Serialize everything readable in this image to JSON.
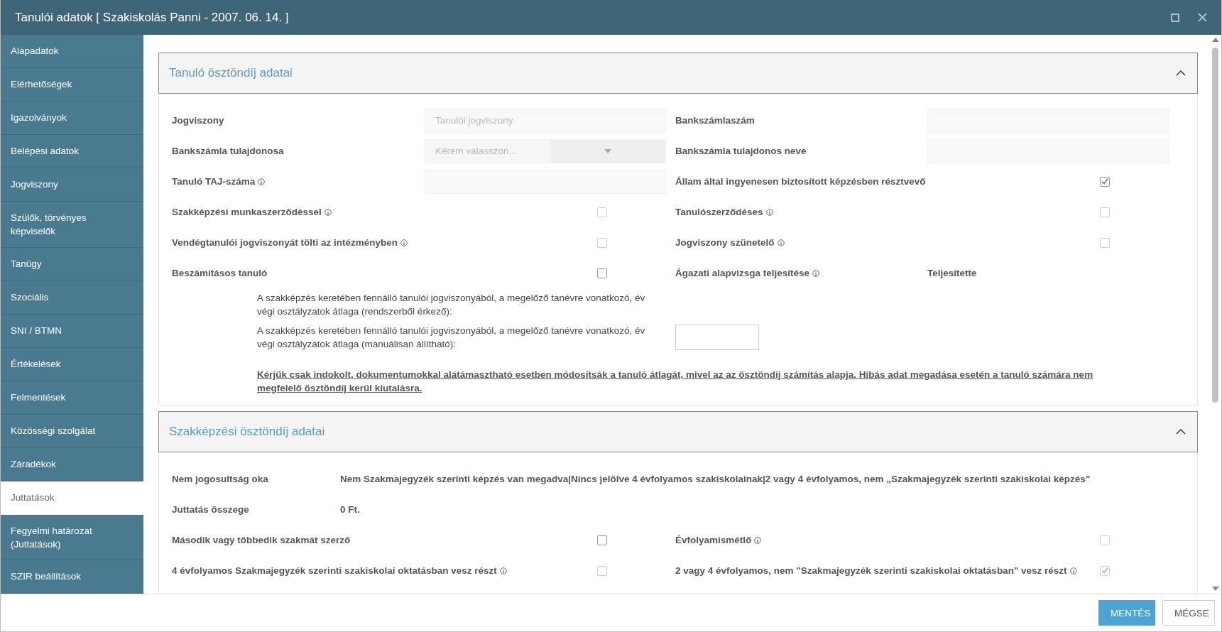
{
  "window": {
    "title": "Tanulói adatok [ Szakiskolás Panni - 2007. 06. 14. ]"
  },
  "sidebar": {
    "items": [
      {
        "label": "Alapadatok",
        "selected": false
      },
      {
        "label": "Elérhetőségek",
        "selected": false
      },
      {
        "label": "Igazolványok",
        "selected": false
      },
      {
        "label": "Belépési adatok",
        "selected": false
      },
      {
        "label": "Jogviszony",
        "selected": false
      },
      {
        "label": "Szülők, törvényes képviselők",
        "selected": false
      },
      {
        "label": "Tanügy",
        "selected": false
      },
      {
        "label": "Szociális",
        "selected": false
      },
      {
        "label": "SNI / BTMN",
        "selected": false
      },
      {
        "label": "Értékelések",
        "selected": false
      },
      {
        "label": "Felmentések",
        "selected": false
      },
      {
        "label": "Közösségi szolgálat",
        "selected": false
      },
      {
        "label": "Záradékok",
        "selected": false
      },
      {
        "label": "Juttatások",
        "selected": true
      },
      {
        "label": "Fegyelmi határozat (Juttatások)",
        "selected": false
      },
      {
        "label": "SZIR beállítások",
        "selected": false
      }
    ]
  },
  "sections": [
    {
      "title": "Tanuló ösztöndíj adatai",
      "expanded": true,
      "rows": [
        {
          "kind": "pair",
          "left": {
            "label": "Jogviszony",
            "info": false,
            "control": {
              "kind": "input",
              "placeholder": "Tanulói jogviszony",
              "disabled": true
            }
          },
          "right": {
            "label": "Bankszámlaszám",
            "info": false,
            "control": {
              "kind": "input",
              "disabled": true
            }
          }
        },
        {
          "kind": "pair",
          "left": {
            "label": "Bankszámla tulajdonosa",
            "info": false,
            "control": {
              "kind": "select",
              "placeholder": "Kérem válasszon...",
              "disabled": true
            }
          },
          "right": {
            "label": "Bankszámla tulajdonos neve",
            "info": false,
            "control": {
              "kind": "input",
              "disabled": true
            }
          }
        },
        {
          "kind": "pair",
          "left": {
            "label": "Tanuló TAJ-száma",
            "info": true,
            "control": {
              "kind": "input",
              "disabled": true
            }
          },
          "right": {
            "label": "Állam által ingyenesen biztosított képzésben résztvevő",
            "info": false,
            "control": {
              "kind": "checkbox",
              "checked": true,
              "disabled": false
            }
          }
        },
        {
          "kind": "pair",
          "left": {
            "label": "Szakképzési munkaszerződéssel",
            "info": true,
            "control": {
              "kind": "checkbox",
              "checked": false,
              "disabled": true
            }
          },
          "right": {
            "label": "Tanulószerződéses",
            "info": true,
            "control": {
              "kind": "checkbox",
              "checked": false,
              "disabled": true
            }
          }
        },
        {
          "kind": "pair",
          "left": {
            "label": "Vendégtanulói jogviszonyát tölti az intézményben",
            "info": true,
            "control": {
              "kind": "checkbox",
              "checked": false,
              "disabled": true
            }
          },
          "right": {
            "label": "Jogviszony szünetelő",
            "info": true,
            "control": {
              "kind": "checkbox",
              "checked": false,
              "disabled": true
            }
          }
        },
        {
          "kind": "pair",
          "left": {
            "label": "Beszámításos tanuló",
            "info": false,
            "control": {
              "kind": "checkbox",
              "checked": false,
              "disabled": false
            }
          },
          "right": {
            "label": "Ágazati alapvizsga teljesítése",
            "info": true,
            "control": {
              "kind": "text",
              "value": "Teljesítette"
            }
          }
        },
        {
          "kind": "average",
          "text": "A szakképzés keretében fennálló tanulói jogviszonyából, a megelőző tanévre vonatkozó, év végi osztályzatok átlaga (rendszerből érkező):"
        },
        {
          "kind": "average",
          "text": "A szakképzés keretében fennálló tanulói jogviszonyából, a megelőző tanévre vonatkozó, év végi osztályzatok átlaga (manuálisan állítható):",
          "control": {
            "kind": "input",
            "disabled": false
          }
        },
        {
          "kind": "notice",
          "text": "Kérjük csak indokolt, dokumentumokkal alátámasztható esetben módosítsák a tanuló átlagát, mivel az az ösztöndíj számítás alapja. Hibás adat megadása esetén a tanuló számára nem megfelelő ösztöndíj kerül kiutalásra."
        }
      ]
    },
    {
      "title": "Szakképzési ösztöndíj adatai",
      "expanded": true,
      "rows": [
        {
          "kind": "info",
          "label": "Nem jogosultság oka",
          "value": "Nem Szakmajegyzék szerinti képzés van megadva|Nincs jelölve 4 évfolyamos szakiskolainak|2 vagy 4 évfolyamos, nem „Szakmajegyzék szerinti szakiskolai képzés”"
        },
        {
          "kind": "info",
          "label": "Juttatás összege",
          "value": "0 Ft."
        },
        {
          "kind": "pair",
          "left": {
            "label": "Második vagy többedik szakmát szerző",
            "info": false,
            "control": {
              "kind": "checkbox",
              "checked": false,
              "disabled": false
            }
          },
          "right": {
            "label": "Évfolyamismétlő",
            "info": true,
            "control": {
              "kind": "checkbox",
              "checked": false,
              "disabled": true
            }
          }
        },
        {
          "kind": "pair",
          "left": {
            "label": "4 évfolyamos Szakmajegyzék szerinti szakiskolai oktatásban vesz részt",
            "info": true,
            "control": {
              "kind": "checkbox",
              "checked": false,
              "disabled": true
            }
          },
          "right": {
            "label": "2 vagy 4 évfolyamos, nem \"Szakmajegyzék szerinti szakiskolai oktatásban\" vesz részt",
            "info": true,
            "control": {
              "kind": "checkbox",
              "checked": true,
              "disabled": true
            }
          }
        }
      ]
    }
  ],
  "footer": {
    "buttons": [
      {
        "label": "MENTÉS",
        "kind": "primary"
      },
      {
        "label": "MÉGSE",
        "kind": "default"
      }
    ]
  }
}
